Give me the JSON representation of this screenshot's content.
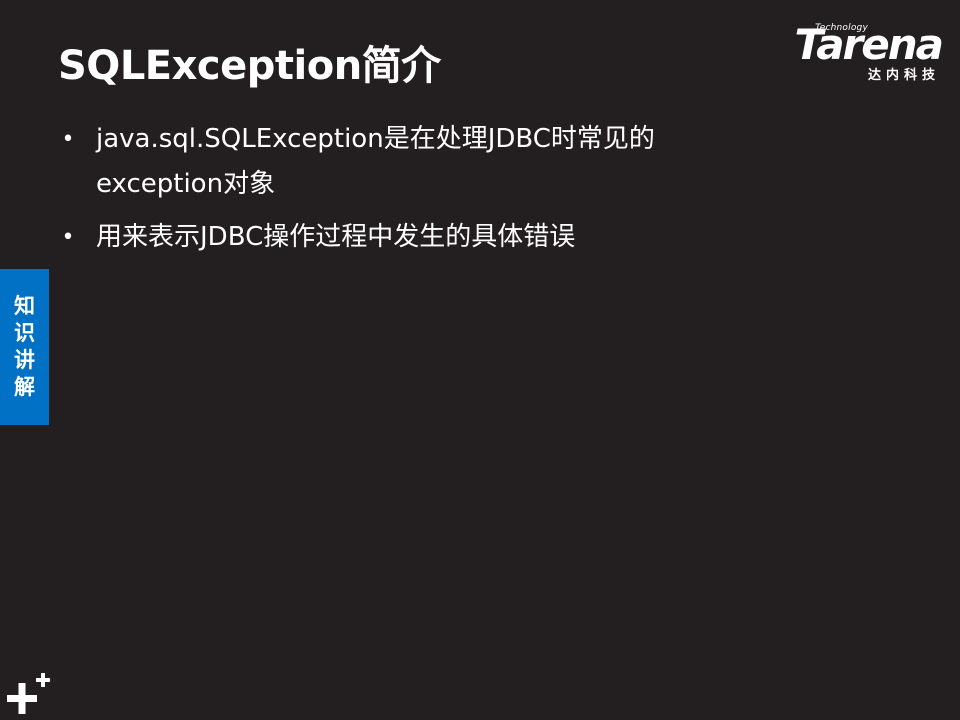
{
  "slide": {
    "title": "SQLException简介",
    "bullets": [
      "java.sql.SQLException是在处理JDBC时常见的exception对象",
      "用来表示JDBC操作过程中发生的具体错误"
    ]
  },
  "logo": {
    "small_text": "Technology",
    "word": "Tarena",
    "chinese": "达内科技"
  },
  "side_tab": {
    "chars": [
      "知",
      "识",
      "讲",
      "解"
    ]
  },
  "colors": {
    "background": "#231f20",
    "accent": "#0071c5",
    "text": "#ffffff"
  },
  "icons": {
    "corner": "plus-icon"
  }
}
